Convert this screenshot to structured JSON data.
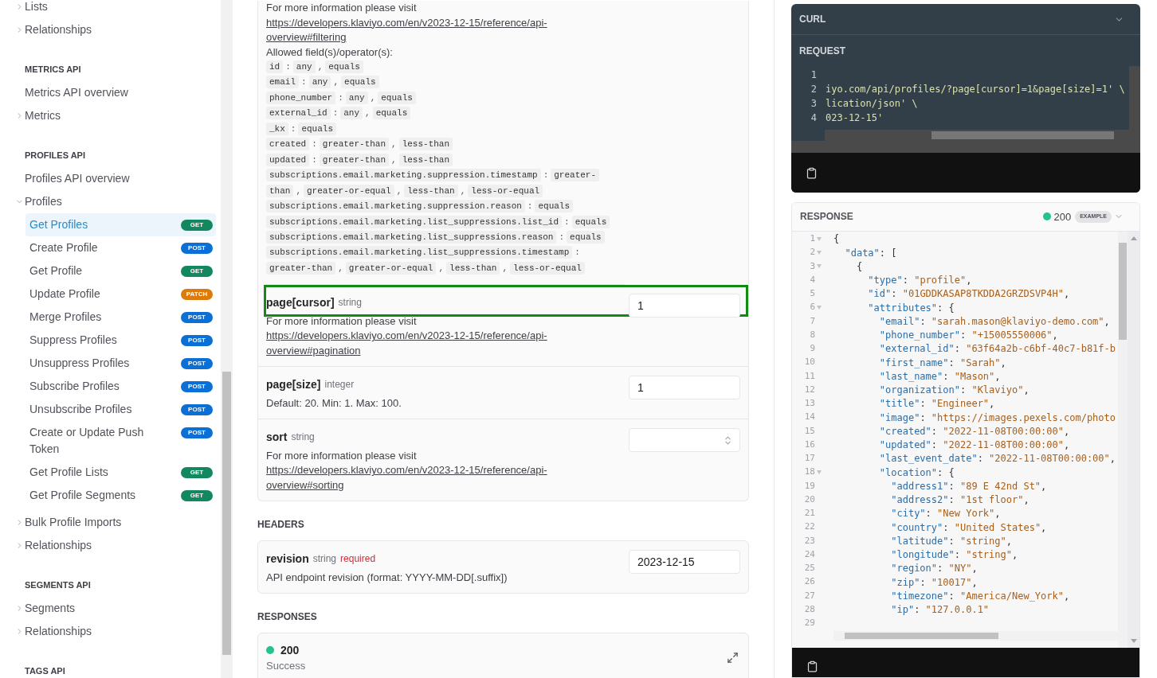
{
  "sidebar": {
    "sections": [
      {
        "items": [
          {
            "label": "Lists",
            "kind": "group",
            "expanded": false
          },
          {
            "label": "Relationships",
            "kind": "group",
            "expanded": false
          }
        ]
      },
      {
        "heading": "METRICS API",
        "items": [
          {
            "label": "Metrics API overview",
            "kind": "link"
          },
          {
            "label": "Metrics",
            "kind": "group",
            "expanded": false
          }
        ]
      },
      {
        "heading": "PROFILES API",
        "items": [
          {
            "label": "Profiles API overview",
            "kind": "link"
          },
          {
            "label": "Profiles",
            "kind": "group",
            "expanded": true,
            "children": [
              {
                "label": "Get Profiles",
                "method": "GET",
                "color": "#13875e",
                "selected": true
              },
              {
                "label": "Create Profile",
                "method": "POST",
                "color": "#0b6fd6",
                "selected": false
              },
              {
                "label": "Get Profile",
                "method": "GET",
                "color": "#13875e",
                "selected": false
              },
              {
                "label": "Update Profile",
                "method": "PATCH",
                "color": "#dc7a0b",
                "selected": false
              },
              {
                "label": "Merge Profiles",
                "method": "POST",
                "color": "#0b6fd6",
                "selected": false
              },
              {
                "label": "Suppress Profiles",
                "method": "POST",
                "color": "#0b6fd6",
                "selected": false
              },
              {
                "label": "Unsuppress Profiles",
                "method": "POST",
                "color": "#0b6fd6",
                "selected": false
              },
              {
                "label": "Subscribe Profiles",
                "method": "POST",
                "color": "#0b6fd6",
                "selected": false
              },
              {
                "label": "Unsubscribe Profiles",
                "method": "POST",
                "color": "#0b6fd6",
                "selected": false
              },
              {
                "label": "Create or Update Push Token",
                "method": "POST",
                "color": "#0b6fd6",
                "selected": false
              },
              {
                "label": "Get Profile Lists",
                "method": "GET",
                "color": "#13875e",
                "selected": false
              },
              {
                "label": "Get Profile Segments",
                "method": "GET",
                "color": "#13875e",
                "selected": false
              }
            ]
          },
          {
            "label": "Bulk Profile Imports",
            "kind": "group",
            "expanded": false
          },
          {
            "label": "Relationships",
            "kind": "group",
            "expanded": false
          }
        ]
      },
      {
        "heading": "SEGMENTS API",
        "items": [
          {
            "label": "Segments",
            "kind": "group",
            "expanded": false
          },
          {
            "label": "Relationships",
            "kind": "group",
            "expanded": false
          }
        ]
      },
      {
        "heading": "TAGS API"
      }
    ]
  },
  "query_parameters": {
    "rows": [
      {
        "kind": "filter",
        "description": "For more information please visit",
        "link": "https://developers.klaviyo.com/en/v2023-12-15/reference/api-overview#filtering",
        "allowed_label": "Allowed field(s)/operator(s):",
        "field_separator": ":",
        "operator_separator": ",",
        "rules": [
          {
            "field": "id",
            "operators": [
              "any",
              "equals"
            ]
          },
          {
            "field": "email",
            "operators": [
              "any",
              "equals"
            ]
          },
          {
            "field": "phone_number",
            "operators": [
              "any",
              "equals"
            ]
          },
          {
            "field": "external_id",
            "operators": [
              "any",
              "equals"
            ]
          },
          {
            "field": "_kx",
            "operators": [
              "equals"
            ]
          },
          {
            "field": "created",
            "operators": [
              "greater-than",
              "less-than"
            ]
          },
          {
            "field": "updated",
            "operators": [
              "greater-than",
              "less-than"
            ]
          },
          {
            "field": "subscriptions.email.marketing.suppression.timestamp",
            "operators": [
              "greater-than",
              "greater-or-equal",
              "less-than",
              "less-or-equal"
            ]
          },
          {
            "field": "subscriptions.email.marketing.suppression.reason",
            "operators": [
              "equals"
            ]
          },
          {
            "field": "subscriptions.email.marketing.list_suppressions.list_id",
            "operators": [
              "equals"
            ]
          },
          {
            "field": "subscriptions.email.marketing.list_suppressions.reason",
            "operators": [
              "equals"
            ]
          },
          {
            "field": "subscriptions.email.marketing.list_suppressions.timestamp",
            "operators": [
              "greater-than",
              "greater-or-equal",
              "less-than",
              "less-or-equal"
            ]
          }
        ]
      },
      {
        "kind": "param",
        "name": "page[cursor]",
        "type": "string",
        "input": {
          "kind": "text",
          "value": "1"
        },
        "highlighted": true,
        "description": "For more information please visit",
        "link": "https://developers.klaviyo.com/en/v2023-12-15/reference/api-overview#pagination"
      },
      {
        "kind": "param",
        "name": "page[size]",
        "type": "integer",
        "input": {
          "kind": "text",
          "value": "1"
        },
        "highlighted": false,
        "description": "Default: 20. Min: 1. Max: 100."
      },
      {
        "kind": "param",
        "name": "sort",
        "type": "string",
        "input": {
          "kind": "select"
        },
        "highlighted": false,
        "description": "For more information please visit",
        "link": "https://developers.klaviyo.com/en/v2023-12-15/reference/api-overview#sorting"
      }
    ]
  },
  "headers": {
    "heading": "HEADERS",
    "rows": [
      {
        "kind": "param",
        "name": "revision",
        "type": "string",
        "flag": "required",
        "input": {
          "kind": "text",
          "value": "2023-12-15"
        },
        "highlighted": false,
        "description": "API endpoint revision (format: YYYY-MM-DD[.suffix])"
      }
    ]
  },
  "responses": {
    "heading": "RESPONSES",
    "items": [
      {
        "status": "200",
        "description": "Success",
        "color": "#22c38e"
      }
    ]
  },
  "request": {
    "title": "CURL",
    "label": "REQUEST",
    "lines": [
      {
        "number": "1"
      },
      {
        "number": "2",
        "text": "iyo.com/api/profiles/?page[cursor]=1&page[size]=1' \\"
      },
      {
        "number": "3",
        "text": "lication/json' \\"
      },
      {
        "number": "4",
        "text": "023-12-15'"
      }
    ]
  },
  "response": {
    "title": "RESPONSE",
    "status": "200",
    "color": "#22c38e",
    "badge": "EXAMPLE",
    "lines": [
      {
        "number": "1",
        "foldable": true,
        "text": "{"
      },
      {
        "number": "2",
        "foldable": true,
        "text": "  \"data\": ["
      },
      {
        "number": "3",
        "foldable": true,
        "text": "    {"
      },
      {
        "number": "4",
        "foldable": false,
        "text": "      \"type\": \"profile\","
      },
      {
        "number": "5",
        "foldable": false,
        "text": "      \"id\": \"01GDDKASAP8TKDDA2GRZDSVP4H\","
      },
      {
        "number": "6",
        "foldable": true,
        "text": "      \"attributes\": {"
      },
      {
        "number": "7",
        "foldable": false,
        "text": "        \"email\": \"sarah.mason@klaviyo-demo.com\","
      },
      {
        "number": "8",
        "foldable": false,
        "text": "        \"phone_number\": \"+15005550006\","
      },
      {
        "number": "9",
        "foldable": false,
        "text": "        \"external_id\": \"63f64a2b-c6bf-40c7-b81f-b"
      },
      {
        "number": "10",
        "foldable": false,
        "text": "        \"first_name\": \"Sarah\","
      },
      {
        "number": "11",
        "foldable": false,
        "text": "        \"last_name\": \"Mason\","
      },
      {
        "number": "12",
        "foldable": false,
        "text": "        \"organization\": \"Klaviyo\","
      },
      {
        "number": "13",
        "foldable": false,
        "text": "        \"title\": \"Engineer\","
      },
      {
        "number": "14",
        "foldable": false,
        "text": "        \"image\": \"https://images.pexels.com/photo"
      },
      {
        "number": "15",
        "foldable": false,
        "text": "        \"created\": \"2022-11-08T00:00:00\","
      },
      {
        "number": "16",
        "foldable": false,
        "text": "        \"updated\": \"2022-11-08T00:00:00\","
      },
      {
        "number": "17",
        "foldable": false,
        "text": "        \"last_event_date\": \"2022-11-08T00:00:00\","
      },
      {
        "number": "18",
        "foldable": true,
        "text": "        \"location\": {"
      },
      {
        "number": "19",
        "foldable": false,
        "text": "          \"address1\": \"89 E 42nd St\","
      },
      {
        "number": "20",
        "foldable": false,
        "text": "          \"address2\": \"1st floor\","
      },
      {
        "number": "21",
        "foldable": false,
        "text": "          \"city\": \"New York\","
      },
      {
        "number": "22",
        "foldable": false,
        "text": "          \"country\": \"United States\","
      },
      {
        "number": "23",
        "foldable": false,
        "text": "          \"latitude\": \"string\","
      },
      {
        "number": "24",
        "foldable": false,
        "text": "          \"longitude\": \"string\","
      },
      {
        "number": "25",
        "foldable": false,
        "text": "          \"region\": \"NY\","
      },
      {
        "number": "26",
        "foldable": false,
        "text": "          \"zip\": \"10017\","
      },
      {
        "number": "27",
        "foldable": false,
        "text": "          \"timezone\": \"America/New_York\","
      },
      {
        "number": "28",
        "foldable": false,
        "text": "          \"ip\": \"127.0.0.1\""
      },
      {
        "number": "29",
        "foldable": false
      }
    ]
  }
}
